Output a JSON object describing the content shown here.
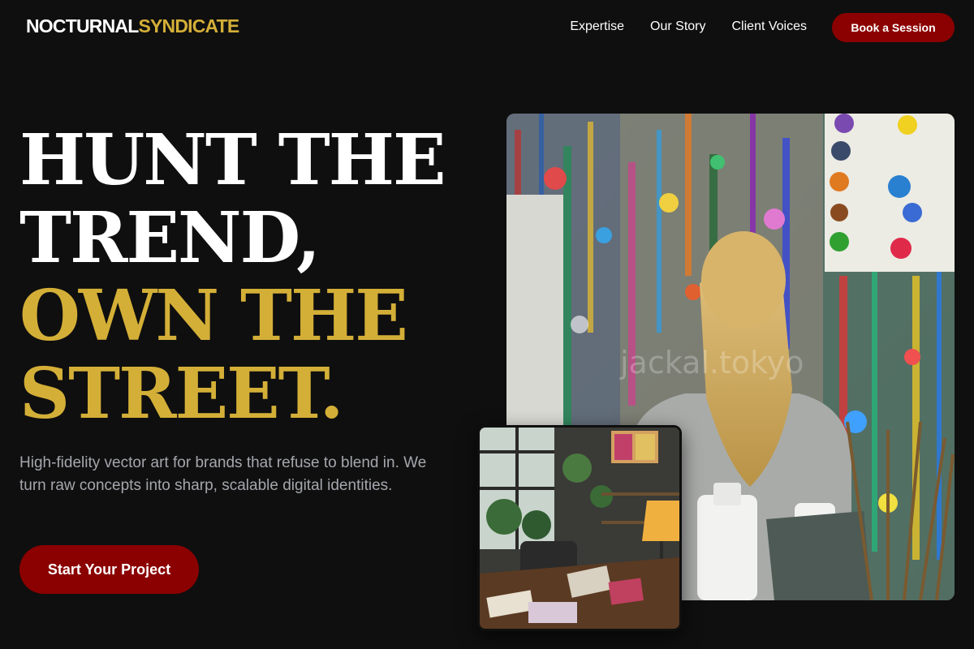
{
  "brand": {
    "part1": "NOCTURNAL",
    "part2": "SYNDICATE"
  },
  "nav": {
    "items": [
      {
        "label": "Expertise"
      },
      {
        "label": "Our Story"
      },
      {
        "label": "Client Voices"
      }
    ],
    "cta_label": "Book a Session"
  },
  "hero": {
    "line1": "HUNT THE",
    "line2": "TREND,",
    "line3": "OWN THE",
    "line4": "STREET.",
    "subtitle": "High-fidelity vector art for brands that refuse to blend in. We turn raw concepts into sharp, scalable digital identities.",
    "cta_label": "Start Your Project"
  },
  "images": {
    "main_watermark": "jackal.tokyo"
  },
  "colors": {
    "background": "#0f0f0f",
    "accent_gold": "#d4af37",
    "accent_red": "#8b0000",
    "muted_text": "#a5a7ad"
  }
}
